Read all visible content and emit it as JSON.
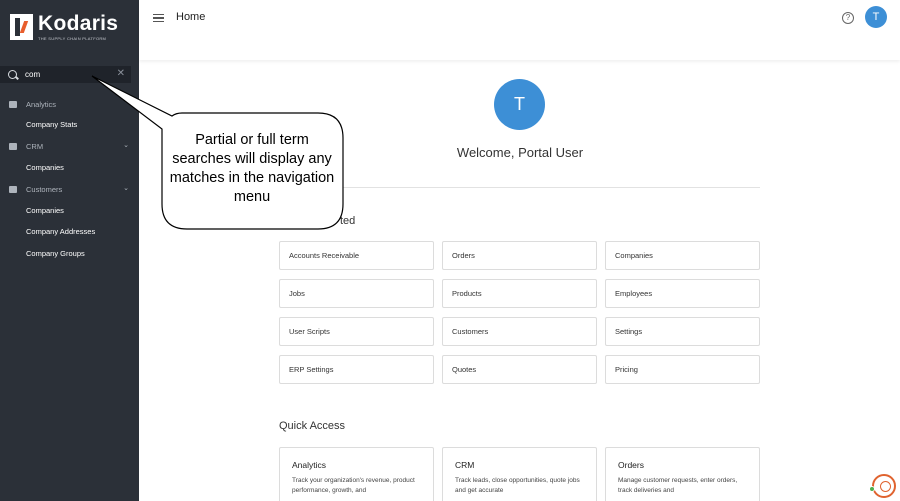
{
  "brand": {
    "name": "Kodaris",
    "tagline": "THE SUPPLY CHAIN PLATFORM",
    "accent_color": "#e85d2c"
  },
  "search": {
    "value": "com",
    "icon": "search-icon",
    "clear_icon": "close-icon"
  },
  "sidebar": {
    "groups": [
      {
        "label": "Analytics",
        "icon": "chart-icon",
        "items": [
          "Company Stats"
        ]
      },
      {
        "label": "CRM",
        "icon": "briefcase-icon",
        "items": [
          "Companies"
        ]
      },
      {
        "label": "Customers",
        "icon": "people-icon",
        "items": [
          "Companies",
          "Company Addresses",
          "Company Groups"
        ]
      }
    ]
  },
  "topbar": {
    "title": "Home",
    "avatar_initial": "T"
  },
  "main": {
    "avatar_initial": "T",
    "welcome": "Welcome, Portal User",
    "section_title_partial": "ted",
    "cards": [
      [
        "Accounts Receivable",
        "Orders",
        "Companies"
      ],
      [
        "Jobs",
        "Products",
        "Employees"
      ],
      [
        "User Scripts",
        "Customers",
        "Settings"
      ],
      [
        "ERP Settings",
        "Quotes",
        "Pricing"
      ]
    ],
    "quick_access_title": "Quick Access",
    "quick_access": [
      {
        "title": "Analytics",
        "desc": "Track your organization's revenue, product performance, growth, and"
      },
      {
        "title": "CRM",
        "desc": "Track leads, close opportunities, quote jobs and get accurate"
      },
      {
        "title": "Orders",
        "desc": "Manage customer requests, enter orders, track deliveries and"
      }
    ]
  },
  "callout": {
    "text": "Partial or full term searches will display any matches in the navigation menu"
  },
  "colors": {
    "sidebar_bg": "#2b3038",
    "avatar_blue": "#3d8fd6"
  }
}
